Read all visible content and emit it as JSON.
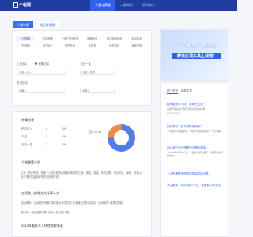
{
  "brand": {
    "logo_text": "个税网"
  },
  "header": {
    "nav": [
      {
        "label": "个税计算器",
        "active": true
      },
      {
        "label": "一税知识"
      },
      {
        "label": "资讯中心"
      }
    ]
  },
  "main": {
    "tabs": [
      {
        "label": "个税计算",
        "active": true
      },
      {
        "label": "税后计算器"
      }
    ],
    "options": [
      "工资薪金",
      "劳务报酬",
      "个体户经营所得",
      "稿酬所得",
      "特许权使用费",
      "利息股息",
      "财产租赁",
      "财产转让",
      "偶然所得",
      "年终奖",
      "股权激励",
      "其他所得"
    ],
    "selected_option": "工资薪金",
    "fields": {
      "salary_label": "工资收入",
      "radio_yes": "无需社保",
      "radio_no": "有需社保",
      "special_label": "五险一金",
      "salary_placeholder": "请输入收入",
      "special_placeholder": "请输入金额",
      "extra_label": "专项扣除",
      "extra_placeholder": "请输入",
      "extra2_placeholder": "请输入"
    }
  },
  "result": {
    "title": "计算结果",
    "rows": [
      {
        "label": "税前收入",
        "value": "0"
      },
      {
        "label": "个税",
        "value": "0"
      },
      {
        "label": "五险一金",
        "value": "0"
      }
    ],
    "percents": [
      "0%",
      "0%",
      "0%"
    ],
    "donut": {
      "label_left": "五险一金 0%",
      "label_right": "个税 0%"
    },
    "section_title_1": "个税政策介绍",
    "para_1": "工资、薪金所得，是指个人因任职或者受雇而取得的工资、薪金、奖金、年终加薪、劳动分红、津贴、补贴以及与任职或者受雇有关的其他所得。",
    "section_title_2": "工资收入扣除方式计算公式",
    "para_2": "应纳税额=（应纳税所得额-减除费用-专项扣除-依法确定的其他扣除）×适用税率-速算扣除数",
    "para_3": "税后收入=应纳税所得额-五险一金-应纳个税",
    "section_title_3": "2019年最新个人所得税税率表"
  },
  "sidebar": {
    "ad_title": "千人薪资 一秒探测",
    "ad_subtitle": "薪资反馈工具上线啦！",
    "tabs": [
      {
        "label": "热门资讯",
        "active": true
      },
      {
        "label": "最新文章"
      }
    ],
    "articles": [
      {
        "title": "租房能退多少钱？答案在这里！",
        "text": "适用于租房的个税专项附加扣除标准",
        "meta": "2019-01-23"
      },
      {
        "title": "如何填写个税专项附加扣除？",
        "text": "“个税改革”措施落地，申报方式如何操作，一文详解",
        "meta": ""
      },
      {
        "title": "2019年个人所得税专项附加扣除",
        "text": "（2018年10月20日，个税的改革迎来了，专项附加扣除信息）",
        "meta": ""
      },
      {
        "title": "个人所得税专项附加扣除常见问题",
        "text": "",
        "meta": ""
      },
      {
        "title": "子女教育：每年能扣1.2万，这里有计算方法",
        "text": "",
        "meta": ""
      }
    ]
  }
}
